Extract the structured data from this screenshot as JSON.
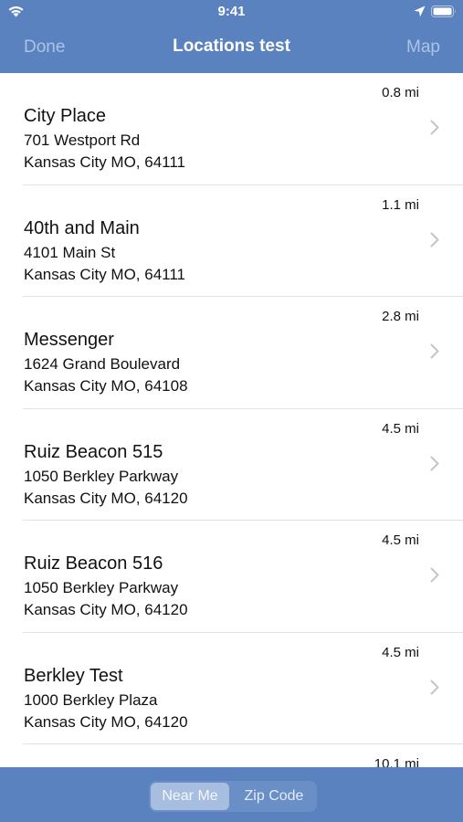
{
  "status_bar": {
    "time": "9:41"
  },
  "nav": {
    "left_label": "Done",
    "title": "Locations test",
    "right_label": "Map"
  },
  "locations": [
    {
      "name": "City Place",
      "street": "701 Westport Rd",
      "city": "Kansas City MO, 64111",
      "distance": "0.8 mi"
    },
    {
      "name": "40th and Main",
      "street": "4101 Main St",
      "city": "Kansas City MO, 64111",
      "distance": "1.1 mi"
    },
    {
      "name": "Messenger",
      "street": "1624 Grand Boulevard",
      "city": "Kansas City MO, 64108",
      "distance": "2.8 mi"
    },
    {
      "name": "Ruiz Beacon 515",
      "street": "1050 Berkley Parkway",
      "city": "Kansas City MO, 64120",
      "distance": "4.5 mi"
    },
    {
      "name": "Ruiz Beacon 516",
      "street": "1050 Berkley Parkway",
      "city": "Kansas City MO, 64120",
      "distance": "4.5 mi"
    },
    {
      "name": "Berkley Test",
      "street": "1000 Berkley Plaza",
      "city": "Kansas City MO, 64120",
      "distance": "4.5 mi"
    },
    {
      "name": "",
      "street": "",
      "city": "",
      "distance": "10.1 mi"
    }
  ],
  "segmented_control": {
    "selected": "Near Me",
    "options": [
      "Near Me",
      "Zip Code"
    ]
  },
  "colors": {
    "bar_background": "#5a82bf",
    "nav_button_text": "#aac3e6",
    "selected_segment": "#a7bee0"
  },
  "icons": {
    "status_left": "wifi-icon",
    "status_right": [
      "location-arrow-icon",
      "battery-icon"
    ],
    "row_accessory": "chevron-right-icon"
  }
}
